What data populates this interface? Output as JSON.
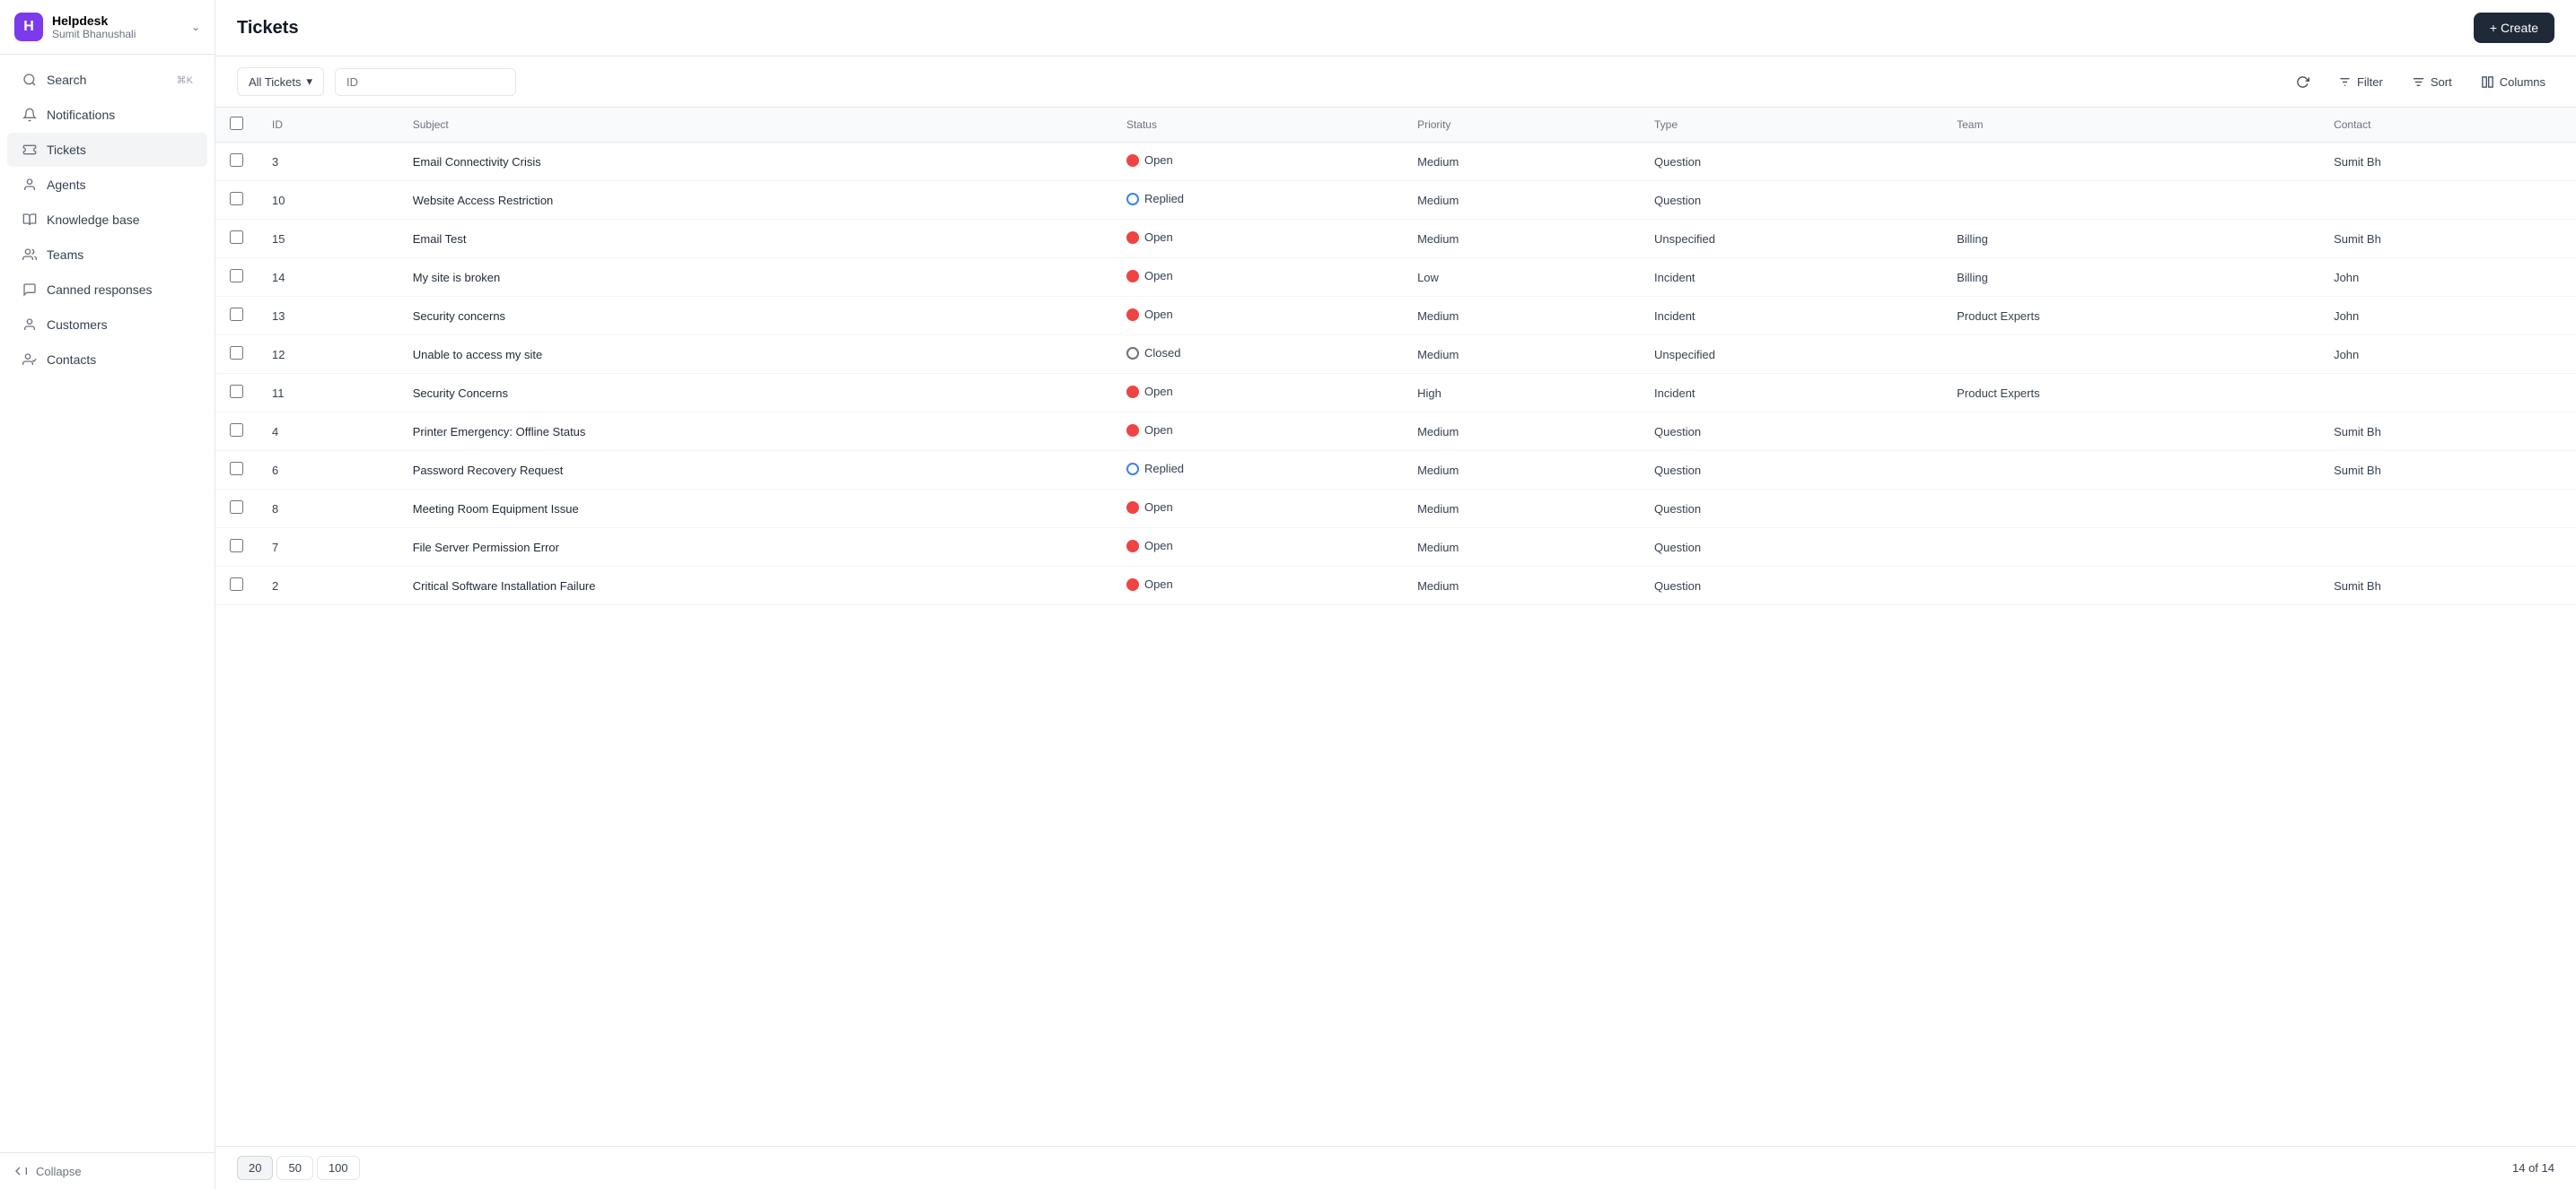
{
  "app": {
    "name": "Helpdesk",
    "user": "Sumit Bhanushali",
    "logo_char": "H"
  },
  "sidebar": {
    "items": [
      {
        "id": "search",
        "label": "Search",
        "shortcut": "⌘K",
        "icon": "search"
      },
      {
        "id": "notifications",
        "label": "Notifications",
        "icon": "bell"
      },
      {
        "id": "tickets",
        "label": "Tickets",
        "icon": "ticket",
        "active": true
      },
      {
        "id": "agents",
        "label": "Agents",
        "icon": "user"
      },
      {
        "id": "knowledge-base",
        "label": "Knowledge base",
        "icon": "book"
      },
      {
        "id": "teams",
        "label": "Teams",
        "icon": "users"
      },
      {
        "id": "canned-responses",
        "label": "Canned responses",
        "icon": "message"
      },
      {
        "id": "customers",
        "label": "Customers",
        "icon": "person"
      },
      {
        "id": "contacts",
        "label": "Contacts",
        "icon": "contact"
      }
    ],
    "collapse_label": "Collapse"
  },
  "toolbar": {
    "filter_label": "All Tickets",
    "search_placeholder": "ID",
    "refresh_icon": "refresh",
    "filter_btn_label": "Filter",
    "sort_btn_label": "Sort",
    "columns_btn_label": "Columns"
  },
  "page": {
    "title": "Tickets",
    "create_label": "+ Create"
  },
  "table": {
    "columns": [
      "ID",
      "Subject",
      "Status",
      "Priority",
      "Type",
      "Team",
      "Contact"
    ],
    "rows": [
      {
        "id": 3,
        "subject": "Email Connectivity Crisis",
        "status": "Open",
        "status_type": "open-filled",
        "priority": "Medium",
        "type": "Question",
        "team": "",
        "contact": "Sumit Bh"
      },
      {
        "id": 10,
        "subject": "Website Access Restriction",
        "status": "Replied",
        "status_type": "replied",
        "priority": "Medium",
        "type": "Question",
        "team": "",
        "contact": ""
      },
      {
        "id": 15,
        "subject": "Email Test",
        "status": "Open",
        "status_type": "open-filled",
        "priority": "Medium",
        "type": "Unspecified",
        "team": "Billing",
        "contact": "Sumit Bh"
      },
      {
        "id": 14,
        "subject": "My site is broken",
        "status": "Open",
        "status_type": "open-filled",
        "priority": "Low",
        "type": "Incident",
        "team": "Billing",
        "contact": "John"
      },
      {
        "id": 13,
        "subject": "Security concerns",
        "status": "Open",
        "status_type": "open-filled",
        "priority": "Medium",
        "type": "Incident",
        "team": "Product Experts",
        "contact": "John"
      },
      {
        "id": 12,
        "subject": "Unable to access my site",
        "status": "Closed",
        "status_type": "closed",
        "priority": "Medium",
        "type": "Unspecified",
        "team": "",
        "contact": "John"
      },
      {
        "id": 11,
        "subject": "Security Concerns",
        "status": "Open",
        "status_type": "open-filled",
        "priority": "High",
        "type": "Incident",
        "team": "Product Experts",
        "contact": ""
      },
      {
        "id": 4,
        "subject": "Printer Emergency: Offline Status",
        "status": "Open",
        "status_type": "open-filled",
        "priority": "Medium",
        "type": "Question",
        "team": "",
        "contact": "Sumit Bh"
      },
      {
        "id": 6,
        "subject": "Password Recovery Request",
        "status": "Replied",
        "status_type": "replied",
        "priority": "Medium",
        "type": "Question",
        "team": "",
        "contact": "Sumit Bh"
      },
      {
        "id": 8,
        "subject": "Meeting Room Equipment Issue",
        "status": "Open",
        "status_type": "open-filled",
        "priority": "Medium",
        "type": "Question",
        "team": "",
        "contact": ""
      },
      {
        "id": 7,
        "subject": "File Server Permission Error",
        "status": "Open",
        "status_type": "open-filled",
        "priority": "Medium",
        "type": "Question",
        "team": "",
        "contact": ""
      },
      {
        "id": 2,
        "subject": "Critical Software Installation Failure",
        "status": "Open",
        "status_type": "open-filled",
        "priority": "Medium",
        "type": "Question",
        "team": "",
        "contact": "Sumit Bh"
      }
    ]
  },
  "footer": {
    "page_sizes": [
      20,
      50,
      100
    ],
    "active_page_size": 20,
    "pagination": "14 of 14"
  }
}
